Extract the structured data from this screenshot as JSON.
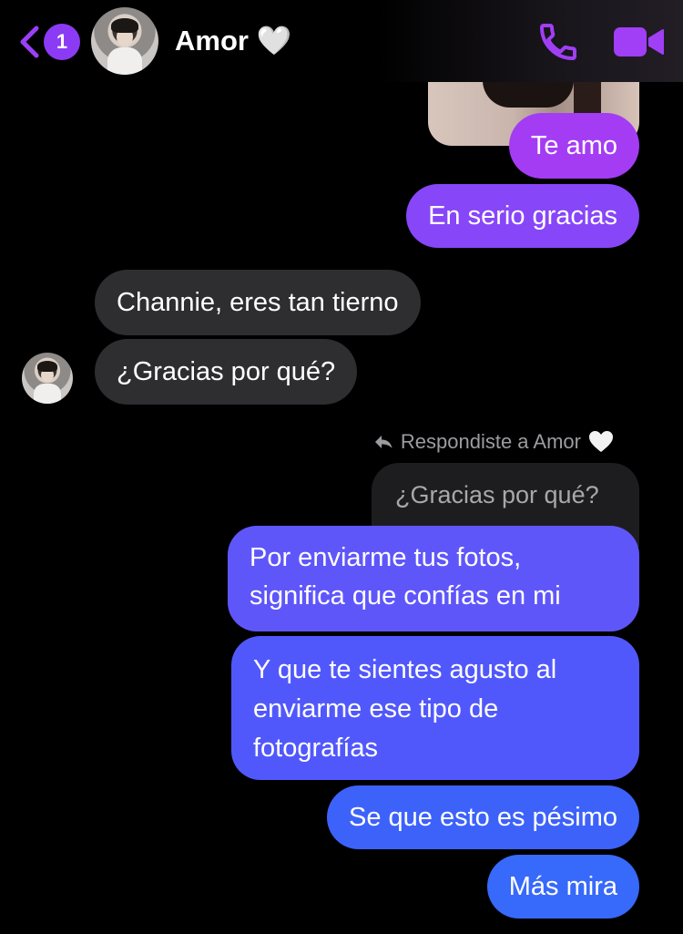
{
  "header": {
    "unread_count": "1",
    "contact_name": "Amor 🤍"
  },
  "messages": [
    {
      "text": "Te amo",
      "direction": "out"
    },
    {
      "text": "En serio gracias",
      "direction": "out"
    },
    {
      "text": "Channie, eres tan tierno",
      "direction": "in"
    },
    {
      "text": "¿Gracias por qué?",
      "direction": "in"
    },
    {
      "text": "Por enviarme tus fotos, significa que confías en mi",
      "direction": "out"
    },
    {
      "text": "Y que te sientes agusto al enviarme ese tipo de fotografías",
      "direction": "out"
    },
    {
      "text": "Se que esto es pésimo",
      "direction": "out"
    },
    {
      "text": "Más mira",
      "direction": "out"
    }
  ],
  "reply": {
    "label": "Respondiste a Amor",
    "quoted_text": "¿Gracias por qué?"
  },
  "colors": {
    "accent": "#8b3bf3",
    "incoming_bubble": "#2e2e30",
    "outgoing_top": "#a43cf4",
    "outgoing_bottom": "#3769fa"
  },
  "icons": [
    "back-chevron-icon",
    "phone-icon",
    "video-camera-icon",
    "reply-arrow-icon",
    "white-heart-icon"
  ]
}
